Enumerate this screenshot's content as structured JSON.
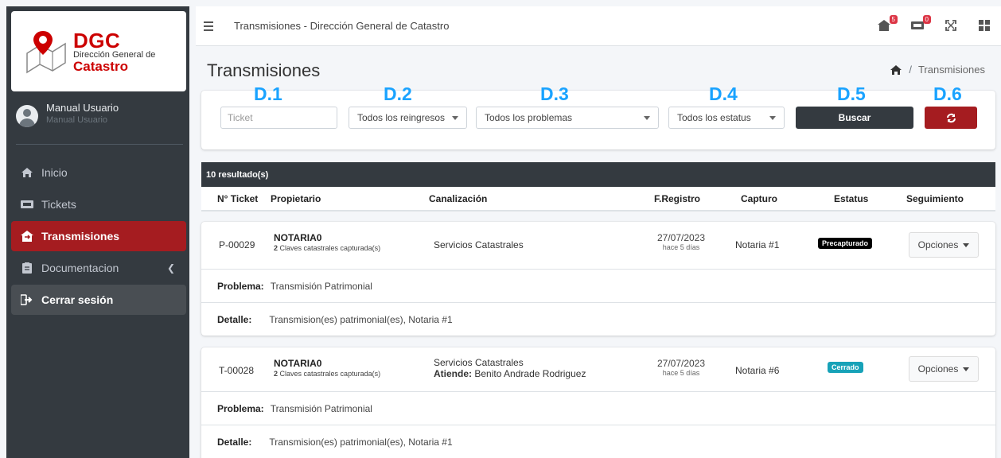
{
  "brand": {
    "title": "DGC",
    "subtitle": "Dirección General de",
    "name": "Catastro"
  },
  "user": {
    "name": "Manual Usuario",
    "role": "Manual Usuario"
  },
  "sidebar": {
    "items": [
      {
        "label": "Inicio",
        "icon": "home-icon"
      },
      {
        "label": "Tickets",
        "icon": "ticket-icon"
      },
      {
        "label": "Transmisiones",
        "icon": "house-transfer-icon",
        "active": true
      },
      {
        "label": "Documentacion",
        "icon": "document-icon"
      },
      {
        "label": "Cerrar sesión",
        "icon": "logout-icon"
      }
    ]
  },
  "topbar": {
    "title": "Transmisiones - Dirección General de Catastro",
    "badges": {
      "transmisiones": "5",
      "tickets": "0"
    }
  },
  "page": {
    "title": "Transmisiones",
    "breadcrumb": "Transmisiones"
  },
  "filters": {
    "labels": [
      "D.1",
      "D.2",
      "D.3",
      "D.4",
      "D.5",
      "D.6"
    ],
    "ticket_placeholder": "Ticket",
    "reingresos": "Todos los reingresos",
    "problemas": "Todos los problemas",
    "estatus": "Todos los estatus",
    "buscar": "Buscar"
  },
  "results": {
    "count_text": "10 resultado(s)"
  },
  "table": {
    "headers": [
      "N° Ticket",
      "Propietario",
      "Canalización",
      "F.Registro",
      "Capturo",
      "Estatus",
      "Seguimiento"
    ]
  },
  "tickets": [
    {
      "id": "P-00029",
      "owner": "NOTARIA0",
      "claves_count": "2",
      "claves_text": "Claves catastrales capturada(s)",
      "canalizacion": "Servicios Catastrales",
      "atiende_label": "",
      "atiende": "",
      "date": "27/07/2023",
      "ago": "hace 5 días",
      "capturo": "Notaria #1",
      "status": "Precapturado",
      "status_color": "#000000",
      "options": "Opciones",
      "problema_label": "Problema:",
      "problema": "Transmisión Patrimonial",
      "detalle_label": "Detalle:",
      "detalle": "Transmision(es) patrimonial(es), Notaria #1"
    },
    {
      "id": "T-00028",
      "owner": "NOTARIA0",
      "claves_count": "2",
      "claves_text": "Claves catastrales capturada(s)",
      "canalizacion": "Servicios Catastrales",
      "atiende_label": "Atiende:",
      "atiende": "Benito Andrade Rodriguez",
      "date": "27/07/2023",
      "ago": "hace 5 días",
      "capturo": "Notaria #6",
      "status": "Cerrado",
      "status_color": "#17a2b8",
      "options": "Opciones",
      "problema_label": "Problema:",
      "problema": "Transmisión Patrimonial",
      "detalle_label": "Detalle:",
      "detalle": "Transmision(es) patrimonial(es), Notaria #1"
    }
  ],
  "colors": {
    "accent": "#a51c20",
    "sidebar": "#343a40",
    "buscar": "#343a40",
    "label": "#1aa3ff"
  }
}
